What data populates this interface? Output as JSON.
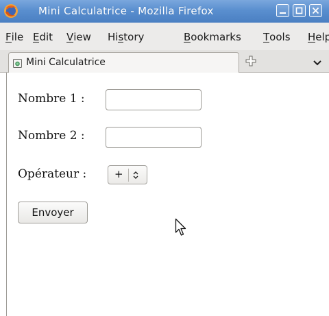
{
  "window": {
    "title": "Mini Calculatrice - Mozilla Firefox"
  },
  "menubar": {
    "items": [
      {
        "label": "File",
        "mnemonic": "F",
        "rest": "ile"
      },
      {
        "label": "Edit",
        "mnemonic": "E",
        "rest": "dit"
      },
      {
        "label": "View",
        "mnemonic": "V",
        "rest": "iew"
      },
      {
        "label": "History",
        "pre": "Hi",
        "mnemonic": "s",
        "rest": "tory"
      },
      {
        "label": "Bookmarks",
        "mnemonic": "B",
        "rest": "ookmarks"
      },
      {
        "label": "Tools",
        "mnemonic": "T",
        "rest": "ools"
      },
      {
        "label": "Help",
        "mnemonic": "H",
        "rest": "elp"
      }
    ]
  },
  "tabs": {
    "active_label": "Mini Calculatrice"
  },
  "form": {
    "nombre1_label": "Nombre 1 :",
    "nombre1_value": "",
    "nombre2_label": "Nombre 2 :",
    "nombre2_value": "",
    "operateur_label": "Opérateur :",
    "operateur_value": "+",
    "submit_label": "Envoyer"
  },
  "icons": {
    "app": "firefox-icon",
    "tab": "page-icon",
    "new_tab": "plus-icon",
    "all_tabs": "chevron-down-icon",
    "minimize": "minimize-icon",
    "maximize": "maximize-icon",
    "close": "close-icon"
  },
  "colors": {
    "titlebar": "#5a8fcf",
    "menubar": "#ecebea",
    "tabstrip": "#e3e2e0"
  }
}
